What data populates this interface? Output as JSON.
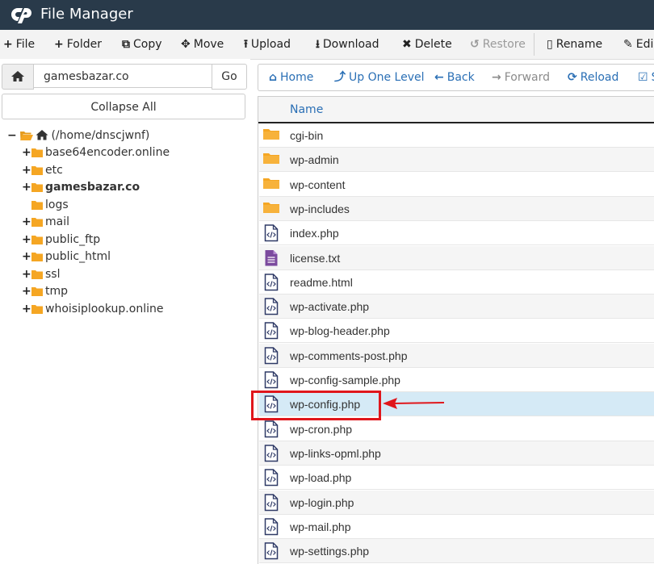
{
  "app": {
    "title": "File Manager",
    "logo": "cP"
  },
  "toolbar": {
    "items": [
      {
        "label": "File",
        "icon": "plus-icon",
        "glyph": "+"
      },
      {
        "label": "Folder",
        "icon": "plus-icon",
        "glyph": "+"
      },
      {
        "label": "Copy",
        "icon": "copy-icon",
        "glyph": "⧉"
      },
      {
        "label": "Move",
        "icon": "move-icon",
        "glyph": "✥"
      },
      {
        "label": "Upload",
        "icon": "upload-icon",
        "glyph": "⭱"
      },
      {
        "label": "Download",
        "icon": "download-icon",
        "glyph": "⭳"
      },
      {
        "label": "Delete",
        "icon": "delete-icon",
        "glyph": "✖"
      },
      {
        "label": "Restore",
        "icon": "restore-icon",
        "glyph": "↺"
      },
      {
        "label": "Rename",
        "icon": "rename-icon",
        "glyph": "▯"
      },
      {
        "label": "Edi",
        "icon": "edit-icon",
        "glyph": "✎"
      }
    ]
  },
  "address": {
    "value": "gamesbazar.co",
    "go_label": "Go"
  },
  "collapse_label": "Collapse All",
  "tree": {
    "root": "(/home/dnscjwnf)",
    "items": [
      {
        "label": "base64encoder.online",
        "toggle": "+"
      },
      {
        "label": "etc",
        "toggle": "+"
      },
      {
        "label": "gamesbazar.co",
        "toggle": "+"
      },
      {
        "label": "logs",
        "toggle": ""
      },
      {
        "label": "mail",
        "toggle": "+"
      },
      {
        "label": "public_ftp",
        "toggle": "+"
      },
      {
        "label": "public_html",
        "toggle": "+"
      },
      {
        "label": "ssl",
        "toggle": "+"
      },
      {
        "label": "tmp",
        "toggle": "+"
      },
      {
        "label": "whoisiplookup.online",
        "toggle": "+"
      }
    ]
  },
  "nav": {
    "items": [
      {
        "label": "Home",
        "glyph": "⌂",
        "icon": "home-icon"
      },
      {
        "label": "Up One Level",
        "glyph": "⤴",
        "icon": "level-up-icon"
      },
      {
        "label": "Back",
        "glyph": "←",
        "icon": "back-arrow-icon"
      },
      {
        "label": "Forward",
        "glyph": "→",
        "icon": "forward-arrow-icon"
      },
      {
        "label": "Reload",
        "glyph": "⟳",
        "icon": "reload-icon"
      },
      {
        "label": "S",
        "glyph": "☑",
        "icon": "select-all-icon"
      }
    ]
  },
  "files": {
    "column_name": "Name",
    "rows": [
      {
        "name": "cgi-bin",
        "type": "folder"
      },
      {
        "name": "wp-admin",
        "type": "folder"
      },
      {
        "name": "wp-content",
        "type": "folder"
      },
      {
        "name": "wp-includes",
        "type": "folder"
      },
      {
        "name": "index.php",
        "type": "code"
      },
      {
        "name": "license.txt",
        "type": "text"
      },
      {
        "name": "readme.html",
        "type": "code"
      },
      {
        "name": "wp-activate.php",
        "type": "code"
      },
      {
        "name": "wp-blog-header.php",
        "type": "code"
      },
      {
        "name": "wp-comments-post.php",
        "type": "code"
      },
      {
        "name": "wp-config-sample.php",
        "type": "code"
      },
      {
        "name": "wp-config.php",
        "type": "code",
        "selected": true
      },
      {
        "name": "wp-cron.php",
        "type": "code"
      },
      {
        "name": "wp-links-opml.php",
        "type": "code"
      },
      {
        "name": "wp-load.php",
        "type": "code"
      },
      {
        "name": "wp-login.php",
        "type": "code"
      },
      {
        "name": "wp-mail.php",
        "type": "code"
      },
      {
        "name": "wp-settings.php",
        "type": "code"
      }
    ]
  },
  "colors": {
    "header_bg": "#293a4a",
    "link_blue": "#2a6fb5",
    "folder": "#f5a623",
    "selected_row": "#d5eaf6",
    "annotation_red": "#e0161b",
    "text_file": "#7b4a9e"
  }
}
